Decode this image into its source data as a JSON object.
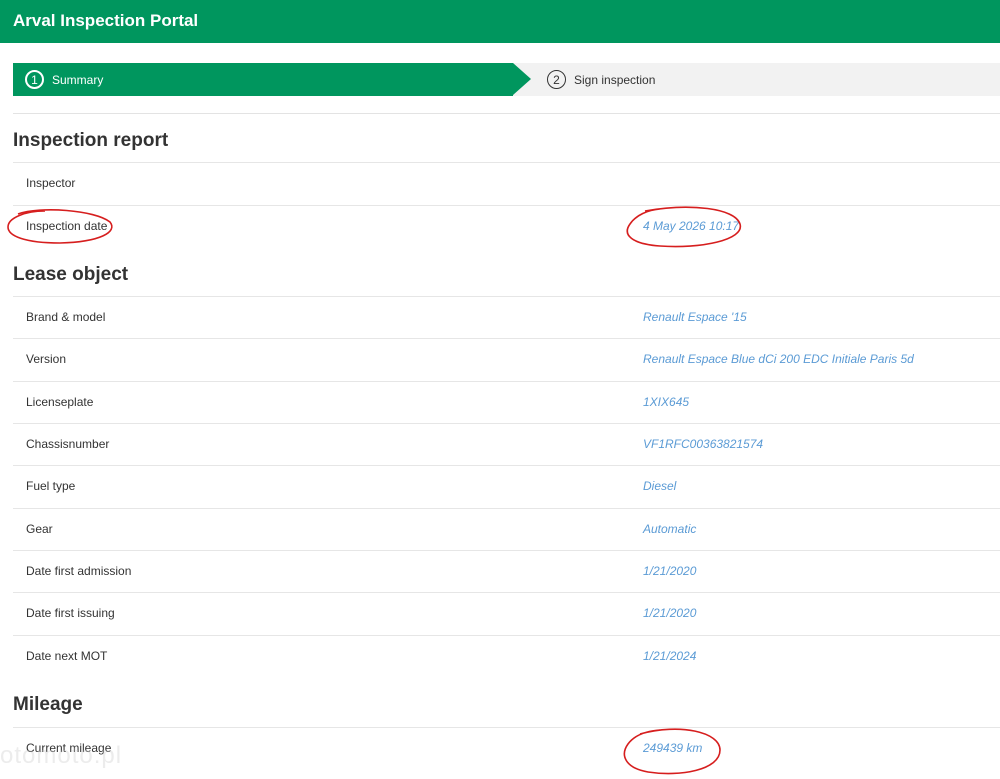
{
  "header": {
    "title": "Arval Inspection Portal"
  },
  "stepper": {
    "steps": [
      {
        "number": "1",
        "label": "Summary",
        "state": "active"
      },
      {
        "number": "2",
        "label": "Sign inspection",
        "state": "inactive"
      }
    ]
  },
  "sections": {
    "inspection_report": {
      "title": "Inspection report",
      "rows": [
        {
          "label": "Inspector",
          "value": ""
        },
        {
          "label": "Inspection date",
          "value": "4 May 2026 10:17"
        }
      ]
    },
    "lease_object": {
      "title": "Lease object",
      "rows": [
        {
          "label": "Brand & model",
          "value": "Renault Espace '15"
        },
        {
          "label": "Version",
          "value": "Renault Espace Blue dCi 200 EDC Initiale Paris 5d"
        },
        {
          "label": "Licenseplate",
          "value": "1XIX645"
        },
        {
          "label": "Chassisnumber",
          "value": "VF1RFC00363821574"
        },
        {
          "label": "Fuel type",
          "value": "Diesel"
        },
        {
          "label": "Gear",
          "value": "Automatic"
        },
        {
          "label": "Date first admission",
          "value": "1/21/2020"
        },
        {
          "label": "Date first issuing",
          "value": "1/21/2020"
        },
        {
          "label": "Date next MOT",
          "value": "1/21/2024"
        }
      ]
    },
    "mileage": {
      "title": "Mileage",
      "rows": [
        {
          "label": "Current mileage",
          "value": "249439 km"
        }
      ]
    }
  },
  "colors": {
    "brand": "#00965e",
    "value_text": "#5b9bd5",
    "annotation": "#d61e1e"
  },
  "watermark": "otomoto.pl"
}
